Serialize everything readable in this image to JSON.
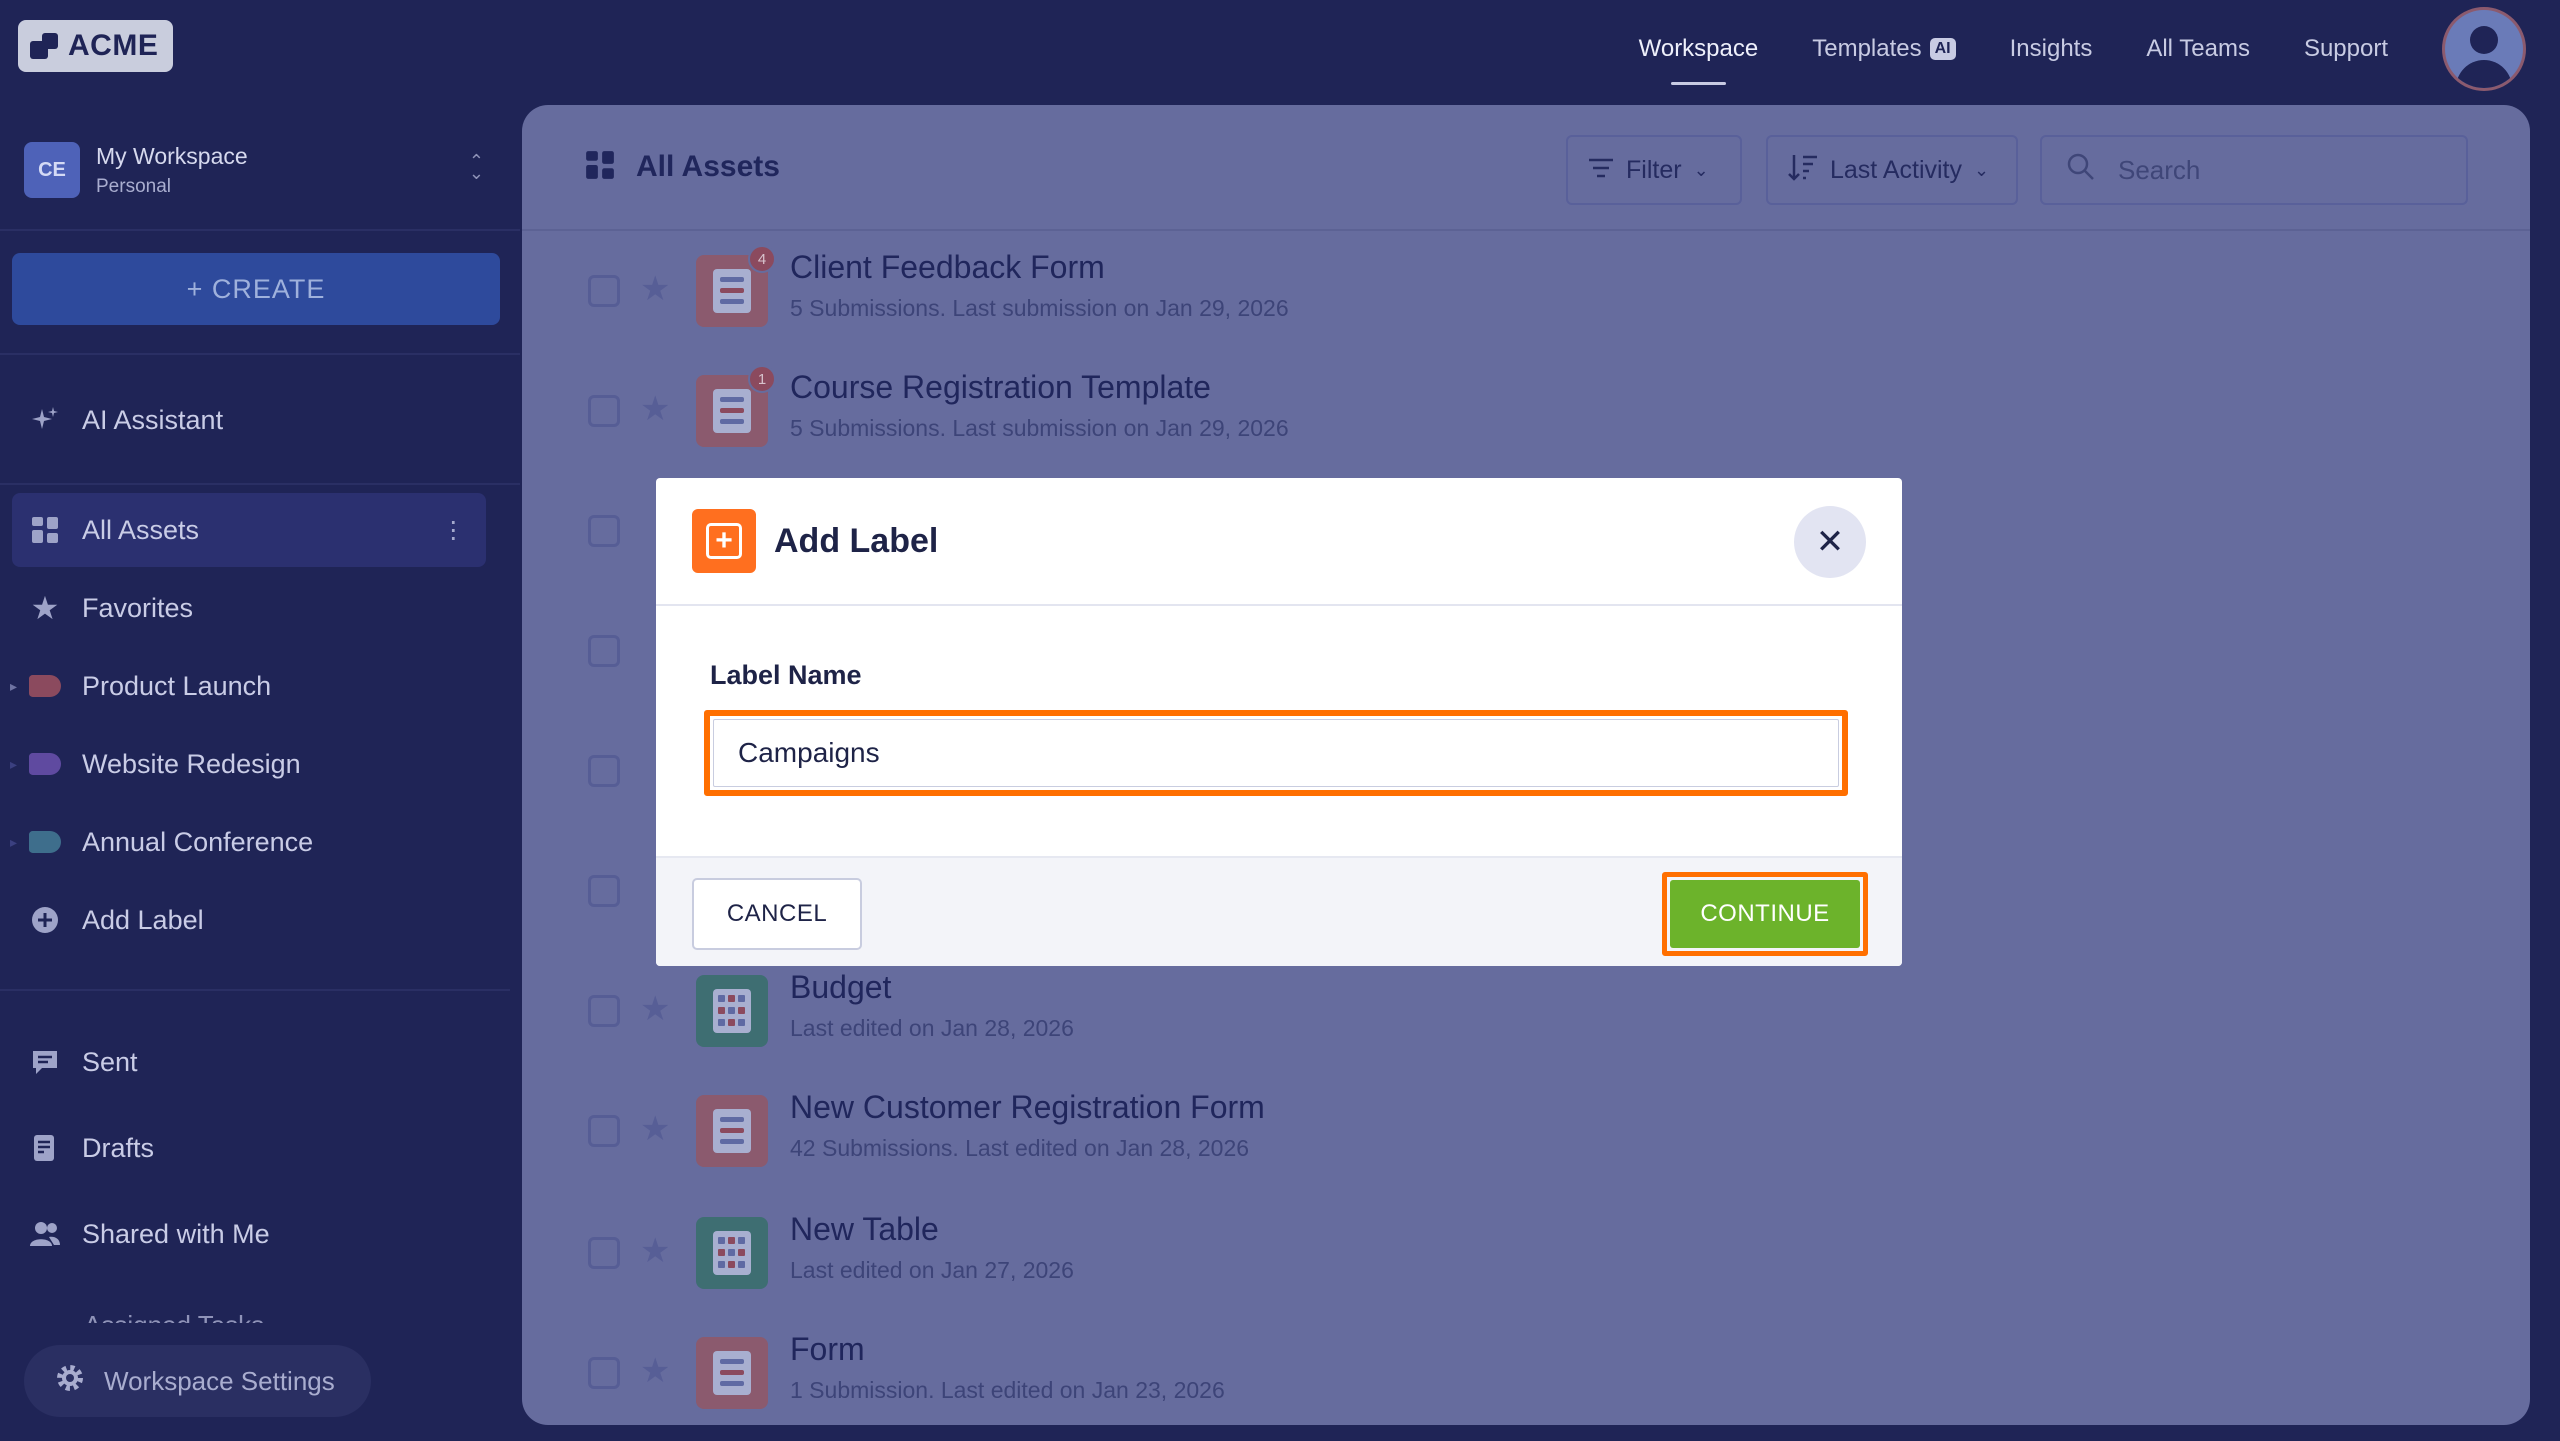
{
  "header": {
    "logo_text": "ACME",
    "nav": [
      {
        "label": "Workspace",
        "active": true
      },
      {
        "label": "Templates",
        "badge": "AI"
      },
      {
        "label": "Insights"
      },
      {
        "label": "All Teams"
      },
      {
        "label": "Support"
      }
    ]
  },
  "sidebar": {
    "workspace": {
      "initials": "CE",
      "name": "My Workspace",
      "type": "Personal"
    },
    "create_label": "+ CREATE",
    "ai_assistant": "AI Assistant",
    "items": [
      {
        "label": "All Assets"
      },
      {
        "label": "Favorites"
      },
      {
        "label": "Product Launch",
        "color": "#8b4a5e"
      },
      {
        "label": "Website Redesign",
        "color": "#5f4aa0"
      },
      {
        "label": "Annual Conference",
        "color": "#3e6e8c"
      },
      {
        "label": "Add Label"
      }
    ],
    "secondary": [
      {
        "label": "Sent"
      },
      {
        "label": "Drafts"
      },
      {
        "label": "Shared with Me"
      },
      {
        "label": "Assigned Tasks"
      }
    ],
    "settings_label": "Workspace Settings"
  },
  "main": {
    "title": "All Assets",
    "filter_label": "Filter",
    "sort_label": "Last Activity",
    "search_placeholder": "Search",
    "assets": [
      {
        "title": "Client Feedback Form",
        "meta": "5 Submissions. Last submission on Jan 29, 2026",
        "kind": "form",
        "badge": "4"
      },
      {
        "title": "Course Registration Template",
        "meta": "5 Submissions. Last submission on Jan 29, 2026",
        "kind": "form",
        "badge": "1"
      },
      {
        "title": "Budget",
        "meta": "Last edited on Jan 28, 2026",
        "kind": "table"
      },
      {
        "title": "New Customer Registration Form",
        "meta": "42 Submissions. Last edited on Jan 28, 2026",
        "kind": "form"
      },
      {
        "title": "New Table",
        "meta": "Last edited on Jan 27, 2026",
        "kind": "table"
      },
      {
        "title": "Form",
        "meta": "1 Submission. Last edited on Jan 23, 2026",
        "kind": "form"
      }
    ]
  },
  "modal": {
    "title": "Add Label",
    "field_label": "Label Name",
    "field_value": "Campaigns",
    "cancel_label": "CANCEL",
    "continue_label": "CONTINUE"
  },
  "colors": {
    "background": "#1f2456",
    "accent_orange": "#ff6f1f",
    "continue_green": "#6cb32b",
    "highlight": "#ff6f00"
  }
}
